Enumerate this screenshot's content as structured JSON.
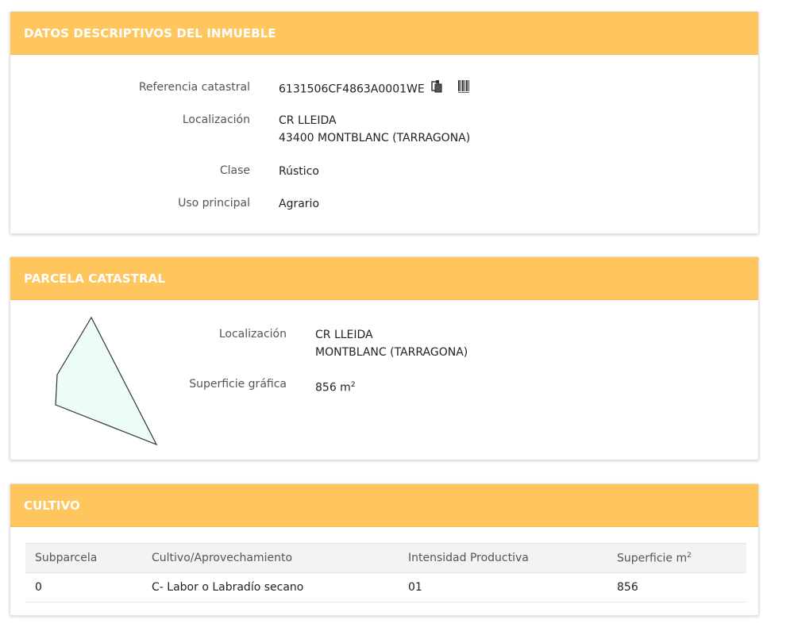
{
  "inmueble": {
    "title": "DATOS DESCRIPTIVOS DEL INMUEBLE",
    "referencia_label": "Referencia catastral",
    "referencia_value": "6131506CF4863A0001WE",
    "localizacion_label": "Localización",
    "localizacion_line1": "CR LLEIDA",
    "localizacion_line2": "43400 MONTBLANC (TARRAGONA)",
    "clase_label": "Clase",
    "clase_value": "Rústico",
    "uso_label": "Uso principal",
    "uso_value": "Agrario"
  },
  "parcela": {
    "title": "PARCELA CATASTRAL",
    "localizacion_label": "Localización",
    "localizacion_line1": "CR LLEIDA",
    "localizacion_line2": "MONTBLANC (TARRAGONA)",
    "superficie_label": "Superficie gráfica",
    "superficie_value": "856 m",
    "superficie_exp": "2",
    "shape_fill": "#ebfdf6",
    "shape_stroke": "#333333"
  },
  "cultivo": {
    "title": "CULTIVO",
    "columns": [
      "Subparcela",
      "Cultivo/Aprovechamiento",
      "Intensidad Productiva",
      "Superficie m"
    ],
    "columns_exp": "2",
    "rows": [
      [
        "0",
        "C- Labor o Labradío secano",
        "01",
        "856"
      ]
    ]
  },
  "icons": [
    "copy-icon",
    "barcode-icon"
  ],
  "colors": {
    "header": "#fec65d",
    "header_text": "#ffffff"
  }
}
